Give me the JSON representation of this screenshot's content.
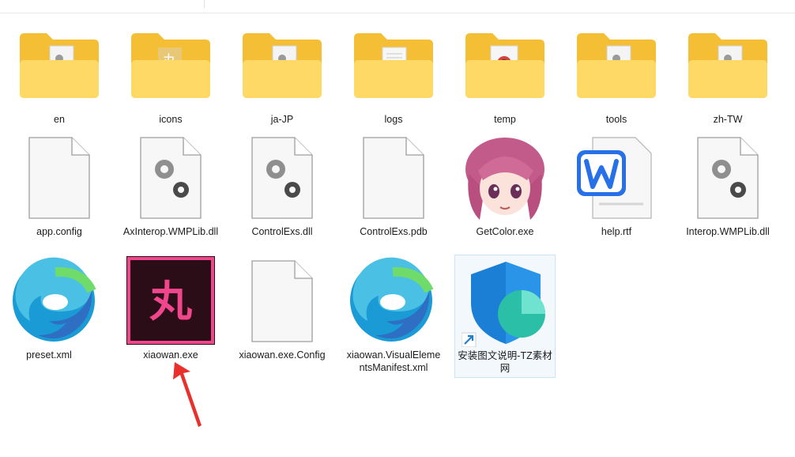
{
  "folders": [
    {
      "name": "en",
      "glyph": "gear"
    },
    {
      "name": "icons",
      "glyph": "glyph"
    },
    {
      "name": "ja-JP",
      "glyph": "gear"
    },
    {
      "name": "logs",
      "glyph": "doc"
    },
    {
      "name": "temp",
      "glyph": "chrome"
    },
    {
      "name": "tools",
      "glyph": "gear"
    },
    {
      "name": "zh-TW",
      "glyph": "gear"
    }
  ],
  "files_row2": [
    {
      "name": "app.config",
      "icon": "blank-file-icon"
    },
    {
      "name": "AxInterop.WMPLib.dll",
      "icon": "dll-gear-icon"
    },
    {
      "name": "ControlExs.dll",
      "icon": "dll-gear-icon"
    },
    {
      "name": "ControlExs.pdb",
      "icon": "blank-file-icon"
    },
    {
      "name": "GetColor.exe",
      "icon": "anime-girl-icon"
    },
    {
      "name": "help.rtf",
      "icon": "wps-writer-icon"
    },
    {
      "name": "Interop.WMPLib.dll",
      "icon": "dll-gear-icon"
    }
  ],
  "files_row3": [
    {
      "name": "preset.xml",
      "icon": "edge-icon"
    },
    {
      "name": "xiaowan.exe",
      "icon": "xiaowan-app-icon",
      "glyph": "丸"
    },
    {
      "name": "xiaowan.exe.Config",
      "icon": "blank-file-icon"
    },
    {
      "name": "xiaowan.VisualElementsManifest.xml",
      "icon": "edge-icon"
    },
    {
      "name": "安装图文说明-TZ素材网",
      "icon": "shield-shortcut-icon"
    }
  ],
  "colors": {
    "folder_back": "#f5c13b",
    "folder_front": "#ffd96a",
    "xiaowan_bg": "#2a0d17",
    "xiaowan_accent": "#f0468c",
    "arrow": "#e8312c",
    "selection": "#cfe3f7"
  }
}
